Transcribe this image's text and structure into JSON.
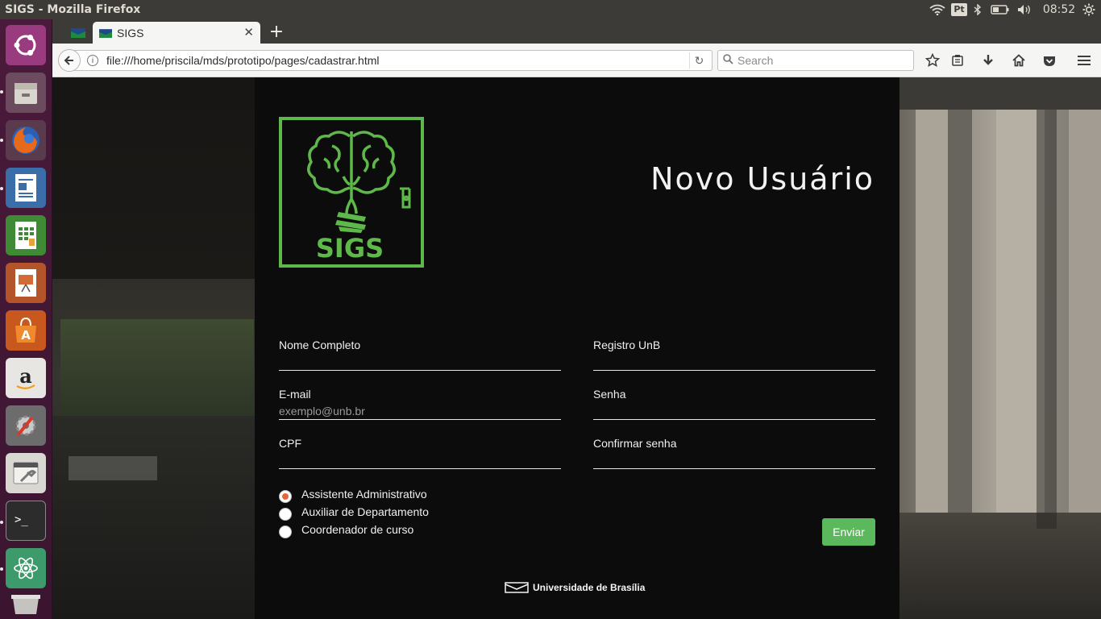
{
  "window": {
    "title": "SIGS - Mozilla Firefox"
  },
  "tray": {
    "keyboard_layout": "Pt",
    "clock": "08:52"
  },
  "launcher": {
    "items": [
      "ubuntu-dash-icon",
      "files-icon",
      "firefox-icon",
      "writer-icon",
      "calc-icon",
      "impress-icon",
      "software-center-icon",
      "amazon-icon",
      "system-settings-icon",
      "system-tools-icon",
      "terminal-icon",
      "atom-icon",
      "trash-icon"
    ]
  },
  "tabs": [
    {
      "label": ""
    },
    {
      "label": "SIGS"
    }
  ],
  "navbar": {
    "url": "file:///home/priscila/mds/prototipo/pages/cadastrar.html",
    "search_placeholder": "Search"
  },
  "form": {
    "title": "Novo Usuário",
    "logo_text": "SIGS",
    "fields": {
      "name": {
        "label": "Nome Completo",
        "placeholder": ""
      },
      "registro": {
        "label": "Registro UnB",
        "placeholder": ""
      },
      "email": {
        "label": "E-mail",
        "placeholder": "exemplo@unb.br"
      },
      "senha": {
        "label": "Senha",
        "placeholder": ""
      },
      "cpf": {
        "label": "CPF",
        "placeholder": ""
      },
      "confirmar": {
        "label": "Confirmar senha",
        "placeholder": ""
      }
    },
    "roles": [
      {
        "label": "Assistente Administrativo",
        "checked": true
      },
      {
        "label": "Auxiliar de Departamento",
        "checked": false
      },
      {
        "label": "Coordenador de curso",
        "checked": false
      }
    ],
    "submit_label": "Enviar",
    "footer_text": "Universidade de Brasília"
  },
  "colors": {
    "accent_green": "#5cb85c",
    "logo_green": "#5fb84a",
    "radio_checked": "#e2683a"
  }
}
